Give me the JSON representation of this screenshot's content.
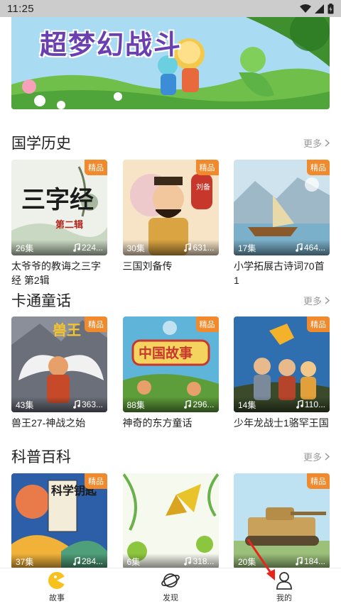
{
  "status_bar": {
    "time": "11:25"
  },
  "banner": {
    "title": "超梦幻战斗"
  },
  "sections": [
    {
      "title": "国学历史",
      "more": "更多",
      "items": [
        {
          "badge": "精品",
          "episodes": "26集",
          "plays": "224...",
          "title": "太爷爷的教诲之三字经 第2辑"
        },
        {
          "badge": "精品",
          "episodes": "30集",
          "plays": "631...",
          "title": "三国刘备传"
        },
        {
          "badge": "精品",
          "episodes": "17集",
          "plays": "464...",
          "title": "小学拓展古诗词70首 1"
        }
      ]
    },
    {
      "title": "卡通童话",
      "more": "更多",
      "items": [
        {
          "badge": "精品",
          "episodes": "43集",
          "plays": "363...",
          "title": "兽王27-神战之始"
        },
        {
          "badge": "精品",
          "episodes": "88集",
          "plays": "296...",
          "title": "神奇的东方童话"
        },
        {
          "badge": "精品",
          "episodes": "14集",
          "plays": "110...",
          "title": "少年龙战士1骆罕王国"
        }
      ]
    },
    {
      "title": "科普百科",
      "more": "更多",
      "items": [
        {
          "badge": "精品",
          "episodes": "37集",
          "plays": "284...",
          "title": ""
        },
        {
          "badge": "",
          "episodes": "6集",
          "plays": "318...",
          "title": ""
        },
        {
          "badge": "精品",
          "episodes": "20集",
          "plays": "184...",
          "title": ""
        }
      ]
    }
  ],
  "covers": {
    "c0": {
      "text1": "三字经",
      "text2": "第二辑"
    },
    "c1": {
      "text1": "刘备"
    },
    "c3": {
      "text1": "兽王"
    },
    "c4": {
      "text1": "中国故事"
    },
    "c6": {
      "text1": "科学钥匙"
    }
  },
  "tabbar": [
    {
      "label": "故事",
      "icon": "story-icon",
      "active": true
    },
    {
      "label": "发现",
      "icon": "planet-icon",
      "active": false
    },
    {
      "label": "我的",
      "icon": "person-icon",
      "active": false
    }
  ],
  "colors": {
    "accent": "#f7c21e",
    "badge": "#f08a2c",
    "annotation_arrow": "#e8241c"
  }
}
